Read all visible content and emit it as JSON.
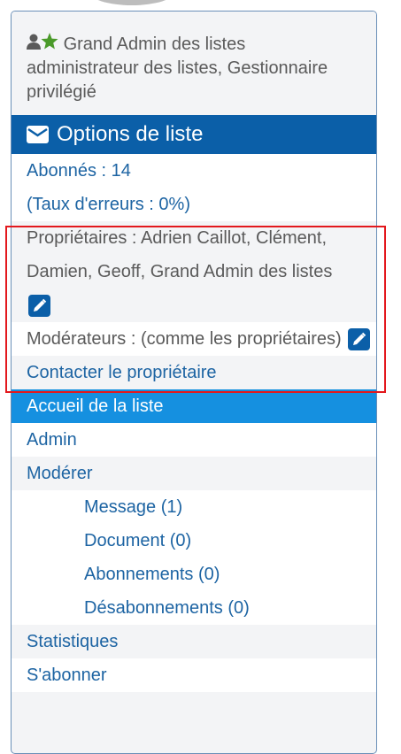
{
  "user": {
    "name": "Grand Admin des listes",
    "roles": "administrateur des listes, Gestionnaire privilégié"
  },
  "options": {
    "title": "Options de liste",
    "subscribers": "Abonnés : 14",
    "error_rate": "(Taux d'erreurs : 0%)",
    "owners": "Propriétaires : Adrien Caillot, Clément, Damien, Geoff, Grand Admin des listes",
    "moderators": "Modérateurs : (comme les propriétaires)"
  },
  "menu": {
    "contact_owner": "Contacter le propriétaire",
    "list_home": "Accueil de la liste",
    "admin": "Admin",
    "moderate": "Modérer",
    "moderate_items": [
      "Message (1)",
      "Document (0)",
      "Abonnements (0)",
      "Désabonnements (0)"
    ],
    "stats": "Statistiques",
    "subscribe": "S'abonner"
  },
  "colors": {
    "header_bg": "#0b5fa8",
    "active_bg": "#1590e0",
    "link": "#1d64a3",
    "highlight": "#e3181d",
    "star": "#4a9a2a"
  },
  "icons": {
    "user": "user-icon",
    "star": "star-icon",
    "mail": "envelope-icon",
    "edit": "pencil-icon"
  }
}
